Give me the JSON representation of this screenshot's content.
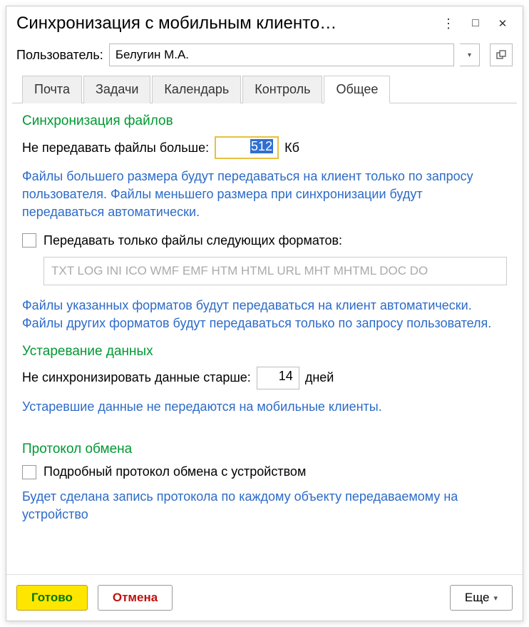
{
  "window": {
    "title": "Синхронизация с мобильным клиенто…"
  },
  "user_row": {
    "label": "Пользователь:",
    "value": "Белугин М.А."
  },
  "tabs": [
    {
      "label": "Почта"
    },
    {
      "label": "Задачи"
    },
    {
      "label": "Календарь"
    },
    {
      "label": "Контроль"
    },
    {
      "label": "Общее",
      "active": true
    }
  ],
  "file_sync": {
    "title": "Синхронизация файлов",
    "size_label": "Не передавать файлы больше:",
    "size_value": "512",
    "size_unit": "Кб",
    "size_hint": "Файлы большего размера будут передаваться на клиент только по запросу пользователя. Файлы меньшего размера при синхронизации будут передаваться автоматически.",
    "formats_checkbox_label": "Передавать только файлы следующих форматов:",
    "formats_placeholder": "TXT LOG INI ICO WMF EMF HTM HTML URL MHT MHTML DOC DO",
    "formats_hint": "Файлы указанных форматов будут передаваться на клиент автоматически. Файлы других форматов будут передаваться только по запросу пользователя."
  },
  "data_aging": {
    "title": "Устаревание данных",
    "days_label": "Не синхронизировать данные старше:",
    "days_value": "14",
    "days_unit": "дней",
    "days_hint": "Устаревшие данные не передаются на мобильные клиенты."
  },
  "protocol": {
    "title": "Протокол обмена",
    "verbose_label": "Подробный протокол обмена с устройством",
    "verbose_hint": "Будет сделана запись протокола по каждому объекту передаваемому на устройство"
  },
  "footer": {
    "ok": "Готово",
    "cancel": "Отмена",
    "more": "Еще"
  }
}
